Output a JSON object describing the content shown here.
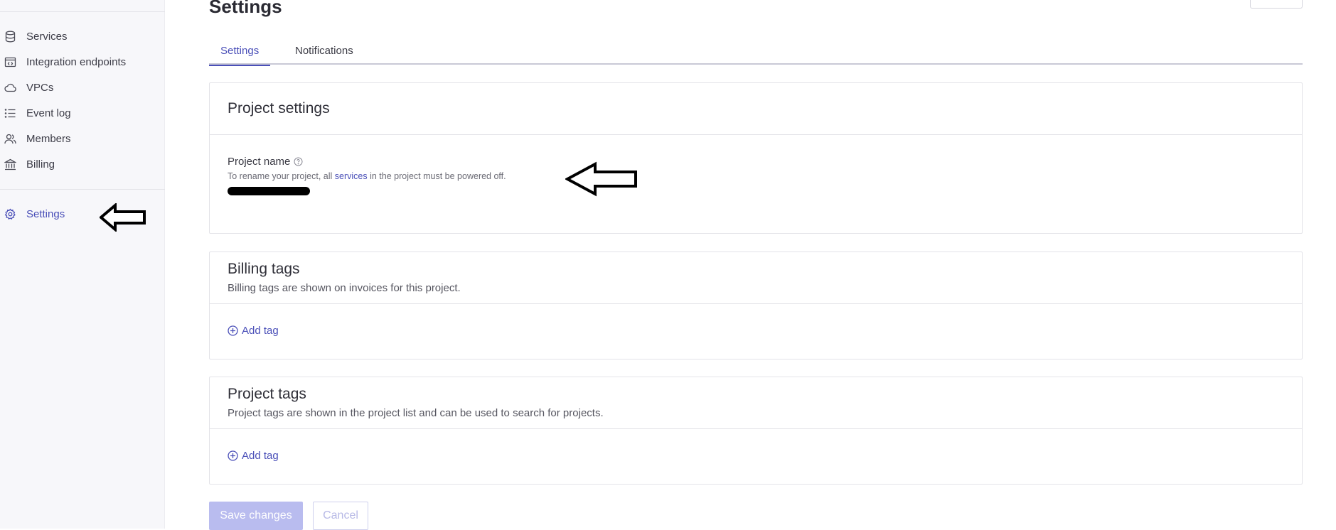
{
  "sidebar": {
    "items": [
      {
        "label": "Services",
        "icon": "database-icon"
      },
      {
        "label": "Integration endpoints",
        "icon": "integration-icon"
      },
      {
        "label": "VPCs",
        "icon": "cloud-icon"
      },
      {
        "label": "Event log",
        "icon": "list-icon"
      },
      {
        "label": "Members",
        "icon": "users-icon"
      },
      {
        "label": "Billing",
        "icon": "bank-icon"
      }
    ],
    "settings": {
      "label": "Settings",
      "icon": "gear-icon",
      "active": true
    }
  },
  "page": {
    "title": "Settings",
    "tabs": [
      {
        "label": "Settings",
        "active": true
      },
      {
        "label": "Notifications",
        "active": false
      }
    ]
  },
  "project_settings": {
    "title": "Project settings",
    "field_label": "Project name",
    "help_prefix": "To rename your project, all ",
    "help_link": "services",
    "help_suffix": " in the project must be powered off."
  },
  "billing_tags": {
    "title": "Billing tags",
    "description": "Billing tags are shown on invoices for this project.",
    "add_label": "Add tag"
  },
  "project_tags": {
    "title": "Project tags",
    "description": "Project tags are shown in the project list and can be used to search for projects.",
    "add_label": "Add tag"
  },
  "actions": {
    "save_label": "Save changes",
    "cancel_label": "Cancel"
  },
  "colors": {
    "accent": "#4a4fb8",
    "sidebar_bg": "#f7f7fa",
    "save_disabled_bg": "#b9bcef"
  }
}
